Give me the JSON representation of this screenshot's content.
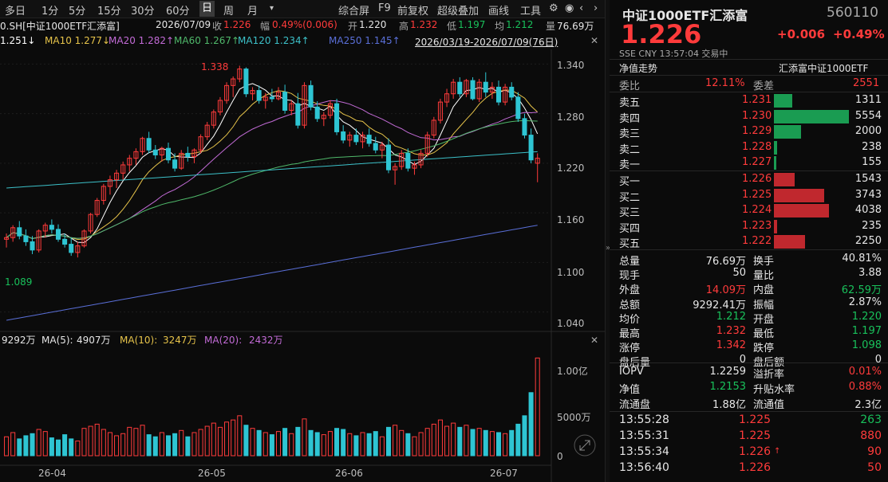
{
  "toolbar": {
    "periods": [
      "多日",
      "1分",
      "5分",
      "15分",
      "30分",
      "60分",
      "日",
      "周",
      "月"
    ],
    "active_period": "日",
    "more_icon": "chevron-down",
    "tools": [
      "综合屏",
      "F9",
      "前复权",
      "超级叠加",
      "画线",
      "工具"
    ],
    "icons": [
      "gear-icon",
      "eye-icon",
      "chevron-left-icon",
      "chevron-right-icon"
    ]
  },
  "infobar": {
    "code": "0.SH[中证1000ETF汇添富]",
    "date": "2026/07/09",
    "close_label": "收",
    "close": "1.226",
    "change_label": "幅",
    "change": "0.49%(0.006)",
    "open_label": "开",
    "open": "1.220",
    "high_label": "高",
    "high": "1.232",
    "low_label": "低",
    "low": "1.197",
    "avg_label": "均",
    "avg": "1.212",
    "vol_label": "量",
    "vol": "76.69万",
    "ma5": "1.251↓",
    "ma10": "MA10 1.277↓",
    "ma20": "MA20 1.282↑",
    "ma60": "MA60 1.267↑",
    "ma120": "MA120 1.234↑",
    "ma250": "MA250 1.145↑",
    "range": "2026/03/19-2026/07/09(76日)"
  },
  "price_axis": [
    "1.340",
    "1.280",
    "1.220",
    "1.160",
    "1.100",
    "1.040"
  ],
  "annotations": {
    "high": "1.338",
    "low": "1.089"
  },
  "volume_header": {
    "vol": "9292万",
    "ma5_label": "MA(5):",
    "ma5": "4907万",
    "ma10_label": "MA(10):",
    "ma10": "3247万",
    "ma20_label": "MA(20):",
    "ma20": "2432万"
  },
  "volume_axis": [
    "1.00亿",
    "5000万",
    "0"
  ],
  "date_axis": [
    "26-04",
    "26-05",
    "26-06",
    "26-07"
  ],
  "colors": {
    "up": "#ff3b3b",
    "down": "#2ec5d3",
    "ma5": "#ffffff",
    "ma10": "#e6c34a",
    "ma20": "#c26bd6",
    "ma60": "#4fb86a",
    "ma120": "#3cc0c8",
    "ma250": "#5a6fd8"
  },
  "chart_data": {
    "type": "candlestick",
    "ylim": [
      1.03,
      1.35
    ],
    "candles": [
      [
        1.128,
        1.135,
        1.118,
        1.13
      ],
      [
        1.13,
        1.145,
        1.125,
        1.142
      ],
      [
        1.142,
        1.15,
        1.128,
        1.132
      ],
      [
        1.132,
        1.14,
        1.12,
        1.125
      ],
      [
        1.125,
        1.132,
        1.11,
        1.115
      ],
      [
        1.115,
        1.14,
        1.112,
        1.138
      ],
      [
        1.138,
        1.148,
        1.13,
        1.145
      ],
      [
        1.145,
        1.152,
        1.135,
        1.14
      ],
      [
        1.14,
        1.146,
        1.125,
        1.128
      ],
      [
        1.128,
        1.135,
        1.118,
        1.122
      ],
      [
        1.122,
        1.13,
        1.108,
        1.112
      ],
      [
        1.112,
        1.125,
        1.106,
        1.12
      ],
      [
        1.12,
        1.14,
        1.118,
        1.138
      ],
      [
        1.138,
        1.16,
        1.135,
        1.158
      ],
      [
        1.158,
        1.178,
        1.155,
        1.175
      ],
      [
        1.175,
        1.195,
        1.17,
        1.192
      ],
      [
        1.192,
        1.205,
        1.182,
        1.2
      ],
      [
        1.2,
        1.212,
        1.19,
        1.208
      ],
      [
        1.208,
        1.222,
        1.2,
        1.218
      ],
      [
        1.218,
        1.23,
        1.21,
        1.226
      ],
      [
        1.226,
        1.238,
        1.218,
        1.234
      ],
      [
        1.234,
        1.252,
        1.23,
        1.25
      ],
      [
        1.25,
        1.258,
        1.232,
        1.236
      ],
      [
        1.236,
        1.242,
        1.225,
        1.23
      ],
      [
        1.23,
        1.24,
        1.222,
        1.238
      ],
      [
        1.238,
        1.245,
        1.22,
        1.224
      ],
      [
        1.224,
        1.232,
        1.21,
        1.214
      ],
      [
        1.214,
        1.236,
        1.212,
        1.232
      ],
      [
        1.232,
        1.24,
        1.222,
        1.228
      ],
      [
        1.228,
        1.238,
        1.22,
        1.236
      ],
      [
        1.236,
        1.255,
        1.232,
        1.252
      ],
      [
        1.252,
        1.27,
        1.248,
        1.266
      ],
      [
        1.266,
        1.285,
        1.262,
        1.282
      ],
      [
        1.282,
        1.3,
        1.278,
        1.296
      ],
      [
        1.296,
        1.318,
        1.292,
        1.314
      ],
      [
        1.314,
        1.325,
        1.3,
        1.322
      ],
      [
        1.322,
        1.338,
        1.318,
        1.334
      ],
      [
        1.334,
        1.336,
        1.3,
        1.304
      ],
      [
        1.304,
        1.312,
        1.296,
        1.308
      ],
      [
        1.308,
        1.314,
        1.292,
        1.296
      ],
      [
        1.296,
        1.305,
        1.286,
        1.3
      ],
      [
        1.3,
        1.31,
        1.294,
        1.298
      ],
      [
        1.298,
        1.312,
        1.296,
        1.306
      ],
      [
        1.306,
        1.315,
        1.28,
        1.284
      ],
      [
        1.284,
        1.296,
        1.278,
        1.292
      ],
      [
        1.292,
        1.305,
        1.262,
        1.266
      ],
      [
        1.266,
        1.318,
        1.262,
        1.314
      ],
      [
        1.314,
        1.32,
        1.284,
        1.288
      ],
      [
        1.288,
        1.295,
        1.27,
        1.274
      ],
      [
        1.274,
        1.282,
        1.265,
        1.278
      ],
      [
        1.278,
        1.296,
        1.274,
        1.292
      ],
      [
        1.292,
        1.298,
        1.254,
        1.258
      ],
      [
        1.258,
        1.266,
        1.244,
        1.248
      ],
      [
        1.248,
        1.258,
        1.24,
        1.254
      ],
      [
        1.254,
        1.262,
        1.242,
        1.246
      ],
      [
        1.246,
        1.258,
        1.238,
        1.254
      ],
      [
        1.254,
        1.262,
        1.24,
        1.244
      ],
      [
        1.244,
        1.252,
        1.232,
        1.236
      ],
      [
        1.236,
        1.246,
        1.226,
        1.242
      ],
      [
        1.242,
        1.25,
        1.208,
        1.212
      ],
      [
        1.212,
        1.22,
        1.194,
        1.216
      ],
      [
        1.216,
        1.236,
        1.212,
        1.232
      ],
      [
        1.232,
        1.238,
        1.21,
        1.214
      ],
      [
        1.214,
        1.222,
        1.206,
        1.218
      ],
      [
        1.218,
        1.236,
        1.214,
        1.232
      ],
      [
        1.232,
        1.258,
        1.228,
        1.254
      ],
      [
        1.254,
        1.276,
        1.25,
        1.272
      ],
      [
        1.272,
        1.298,
        1.268,
        1.294
      ],
      [
        1.294,
        1.31,
        1.288,
        1.304
      ],
      [
        1.304,
        1.322,
        1.298,
        1.318
      ],
      [
        1.318,
        1.324,
        1.3,
        1.304
      ],
      [
        1.304,
        1.322,
        1.3,
        1.32
      ],
      [
        1.32,
        1.324,
        1.296,
        1.298
      ],
      [
        1.298,
        1.322,
        1.294,
        1.318
      ],
      [
        1.318,
        1.33,
        1.3,
        1.306
      ],
      [
        1.306,
        1.318,
        1.298,
        1.312
      ],
      [
        1.312,
        1.32,
        1.29,
        1.294
      ],
      [
        1.294,
        1.316,
        1.29,
        1.312
      ],
      [
        1.312,
        1.318,
        1.296,
        1.3
      ],
      [
        1.3,
        1.306,
        1.27,
        1.274
      ],
      [
        1.274,
        1.28,
        1.25,
        1.254
      ],
      [
        1.254,
        1.262,
        1.22,
        1.224
      ],
      [
        1.22,
        1.232,
        1.197,
        1.226
      ]
    ],
    "volume": [
      1800,
      2200,
      1600,
      1900,
      2100,
      2500,
      2300,
      1700,
      1500,
      2000,
      1600,
      1400,
      2600,
      2800,
      3000,
      2500,
      2200,
      1900,
      2100,
      2700,
      2600,
      2900,
      2000,
      1800,
      2200,
      1900,
      2100,
      2400,
      1800,
      2200,
      2500,
      2800,
      3100,
      2700,
      3200,
      3400,
      3800,
      2900,
      2600,
      2400,
      2200,
      2000,
      2300,
      2600,
      2100,
      2700,
      3500,
      2400,
      2200,
      2000,
      2300,
      2600,
      2500,
      2100,
      1900,
      2200,
      2100,
      2300,
      1800,
      2700,
      2900,
      2400,
      2100,
      1800,
      2200,
      2600,
      3000,
      3400,
      2800,
      3100,
      2700,
      2900,
      2500,
      2600,
      2400,
      2300,
      2200,
      2100,
      2400,
      3000,
      3800,
      6000,
      9292
    ]
  },
  "quote": {
    "name": "中证1000ETF汇添富",
    "code": "560110",
    "price": "1.226",
    "change": "+0.006",
    "pct": "+0.49%",
    "meta": "SSE CNY 13:57:04 交易中",
    "trend_label": "净值走势",
    "fund_name": "汇添富中证1000ETF",
    "wb_label": "委比",
    "wb": "12.11%",
    "wc_label": "委差",
    "wc": "2551",
    "asks": [
      {
        "label": "卖五",
        "price": "1.231",
        "vol": "1311",
        "pct": 0.24
      },
      {
        "label": "卖四",
        "price": "1.230",
        "vol": "5554",
        "pct": 1.0
      },
      {
        "label": "卖三",
        "price": "1.229",
        "vol": "2000",
        "pct": 0.36
      },
      {
        "label": "卖二",
        "price": "1.228",
        "vol": "238",
        "pct": 0.04
      },
      {
        "label": "卖一",
        "price": "1.227",
        "vol": "155",
        "pct": 0.03
      }
    ],
    "bids": [
      {
        "label": "买一",
        "price": "1.226",
        "vol": "1543",
        "pct": 0.28
      },
      {
        "label": "买二",
        "price": "1.225",
        "vol": "3743",
        "pct": 0.67
      },
      {
        "label": "买三",
        "price": "1.224",
        "vol": "4038",
        "pct": 0.73
      },
      {
        "label": "买四",
        "price": "1.223",
        "vol": "235",
        "pct": 0.04
      },
      {
        "label": "买五",
        "price": "1.222",
        "vol": "2250",
        "pct": 0.41
      }
    ],
    "stats": [
      [
        "总量",
        "76.69万",
        "white",
        "换手",
        "40.81%",
        "white"
      ],
      [
        "现手",
        "50",
        "white",
        "量比",
        "3.88",
        "white"
      ],
      [
        "外盘",
        "14.09万",
        "red",
        "内盘",
        "62.59万",
        "green"
      ],
      [
        "总额",
        "9292.41万",
        "white",
        "振幅",
        "2.87%",
        "white"
      ],
      [
        "均价",
        "1.212",
        "green",
        "开盘",
        "1.220",
        "green"
      ],
      [
        "最高",
        "1.232",
        "red",
        "最低",
        "1.197",
        "green"
      ],
      [
        "涨停",
        "1.342",
        "red",
        "跌停",
        "1.098",
        "green"
      ],
      [
        "盘后量",
        "0",
        "white",
        "盘后额",
        "0",
        "white"
      ]
    ],
    "extra": [
      [
        "IOPV",
        "1.2259",
        "white",
        "溢折率",
        "0.01%",
        "red"
      ],
      [
        "净值",
        "1.2153",
        "green",
        "升贴水率",
        "0.88%",
        "red"
      ],
      [
        "流通盘",
        "1.88亿",
        "white",
        "流通值",
        "2.3亿",
        "white"
      ]
    ],
    "ticks": [
      {
        "time": "13:55:28",
        "price": "1.225",
        "vol": "263",
        "dir": "",
        "vcolor": "green"
      },
      {
        "time": "13:55:31",
        "price": "1.225",
        "vol": "880",
        "dir": "",
        "vcolor": "red"
      },
      {
        "time": "13:55:34",
        "price": "1.226",
        "vol": "90",
        "dir": "↑",
        "vcolor": "red"
      },
      {
        "time": "13:56:40",
        "price": "1.226",
        "vol": "50",
        "dir": "",
        "vcolor": "red"
      }
    ]
  }
}
